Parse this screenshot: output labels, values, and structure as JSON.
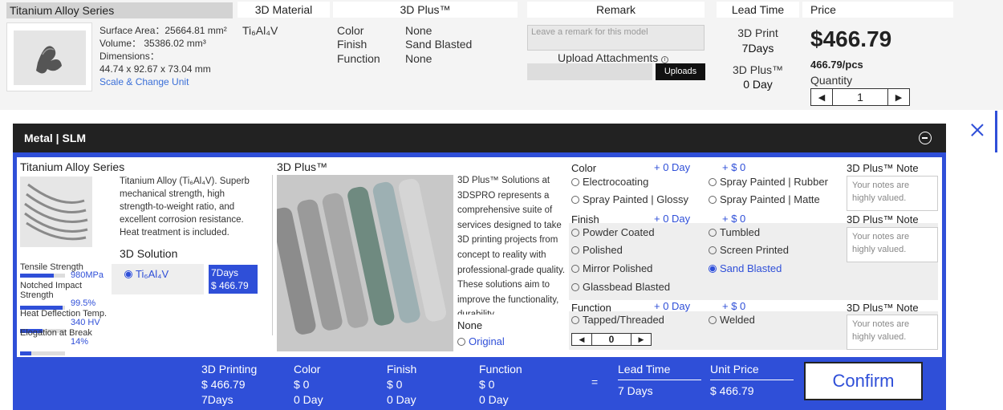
{
  "header": {
    "series": "Titanium Alloy Series",
    "col_material": "3D Material",
    "col_plus": "3D Plus™",
    "col_remark": "Remark",
    "col_lead": "Lead Time",
    "col_price": "Price"
  },
  "model": {
    "surface_area": "Surface Area：25664.81 mm²",
    "volume": "Volume： 35386.02 mm³",
    "dimensions_label": "Dimensions：",
    "dimensions": "44.74 x 92.67 x 73.04 mm",
    "scale_link": "Scale & Change Unit",
    "material": "Ti₆Al₄V",
    "color_label": "Color",
    "color_value": "None",
    "finish_label": "Finish",
    "finish_value": "Sand Blasted",
    "function_label": "Function",
    "function_value": "None",
    "remark_placeholder": "Leave a remark for this model",
    "upload_label": "Upload Attachments",
    "upload_button": "Uploads",
    "lead_print_label": "3D Print",
    "lead_print_value": "7Days",
    "lead_plus_label": "3D Plus™",
    "lead_plus_value": "0 Day",
    "price": "$466.79",
    "unit_price": "466.79/pcs",
    "quantity_label": "Quantity",
    "quantity": "1"
  },
  "panel": {
    "title": "Metal | SLM",
    "series": "Titanium Alloy Series",
    "desc": "Titanium Alloy (Ti₆Al₄V). Superb mechanical strength, high strength-to-weight ratio, and excellent corrosion resistance. Heat treatment is included.",
    "stats": [
      {
        "label": "Tensile Strength",
        "value": "980MPa",
        "fill": 0.75
      },
      {
        "label": "Notched Impact Strength",
        "value": "99.5%",
        "fill": 0.95
      },
      {
        "label": "Heat Deflection Temp.",
        "value": "340 HV",
        "fill": 0.5
      },
      {
        "label": "Elogation at Break",
        "value": "14%",
        "fill": 0.25
      }
    ],
    "solution_title": "3D Solution",
    "solution_option": "Ti₆Al₄V",
    "solution_days": "7Days",
    "solution_price": "$ 466.79",
    "plus_title": "3D Plus™",
    "plus_desc": "3D Plus™ Solutions at 3DSPRO represents a comprehensive suite of services designed to take 3D printing projects from concept to reality with professional-grade quality. These solutions aim to improve the functionality, durability,",
    "plus_none": "None",
    "plus_original": "Original",
    "color": {
      "title": "Color",
      "day": "+ 0 Day",
      "cost": "+ $ 0",
      "note_title": "3D Plus™ Note",
      "options": [
        "Electrocoating",
        "Spray Painted | Rubber",
        "Spray Painted | Glossy",
        "Spray Painted | Matte"
      ]
    },
    "finish": {
      "title": "Finish",
      "day": "+ 0 Day",
      "cost": "+ $ 0",
      "note_title": "3D Plus™ Note",
      "options": [
        "Powder Coated",
        "Tumbled",
        "Polished",
        "Screen Printed",
        "Mirror Polished",
        "Sand Blasted",
        "Glassbead Blasted"
      ]
    },
    "function": {
      "title": "Function",
      "day": "+ 0 Day",
      "cost": "+ $ 0",
      "note_title": "3D Plus™ Note",
      "options": [
        "Tapped/Threaded",
        "Welded"
      ],
      "qty": "0"
    },
    "note_placeholder": "Your notes are highly valued."
  },
  "summary": {
    "printing_label": "3D Printing",
    "printing_price": "$ 466.79",
    "printing_days": "7Days",
    "color_label": "Color",
    "color_price": "$ 0",
    "color_days": "0 Day",
    "finish_label": "Finish",
    "finish_price": "$ 0",
    "finish_days": "0 Day",
    "function_label": "Function",
    "function_price": "$ 0",
    "function_days": "0 Day",
    "equals": "=",
    "lead_label": "Lead Time",
    "lead_value": "7 Days",
    "unit_label": "Unit Price",
    "unit_value": "$ 466.79",
    "confirm": "Confirm"
  }
}
